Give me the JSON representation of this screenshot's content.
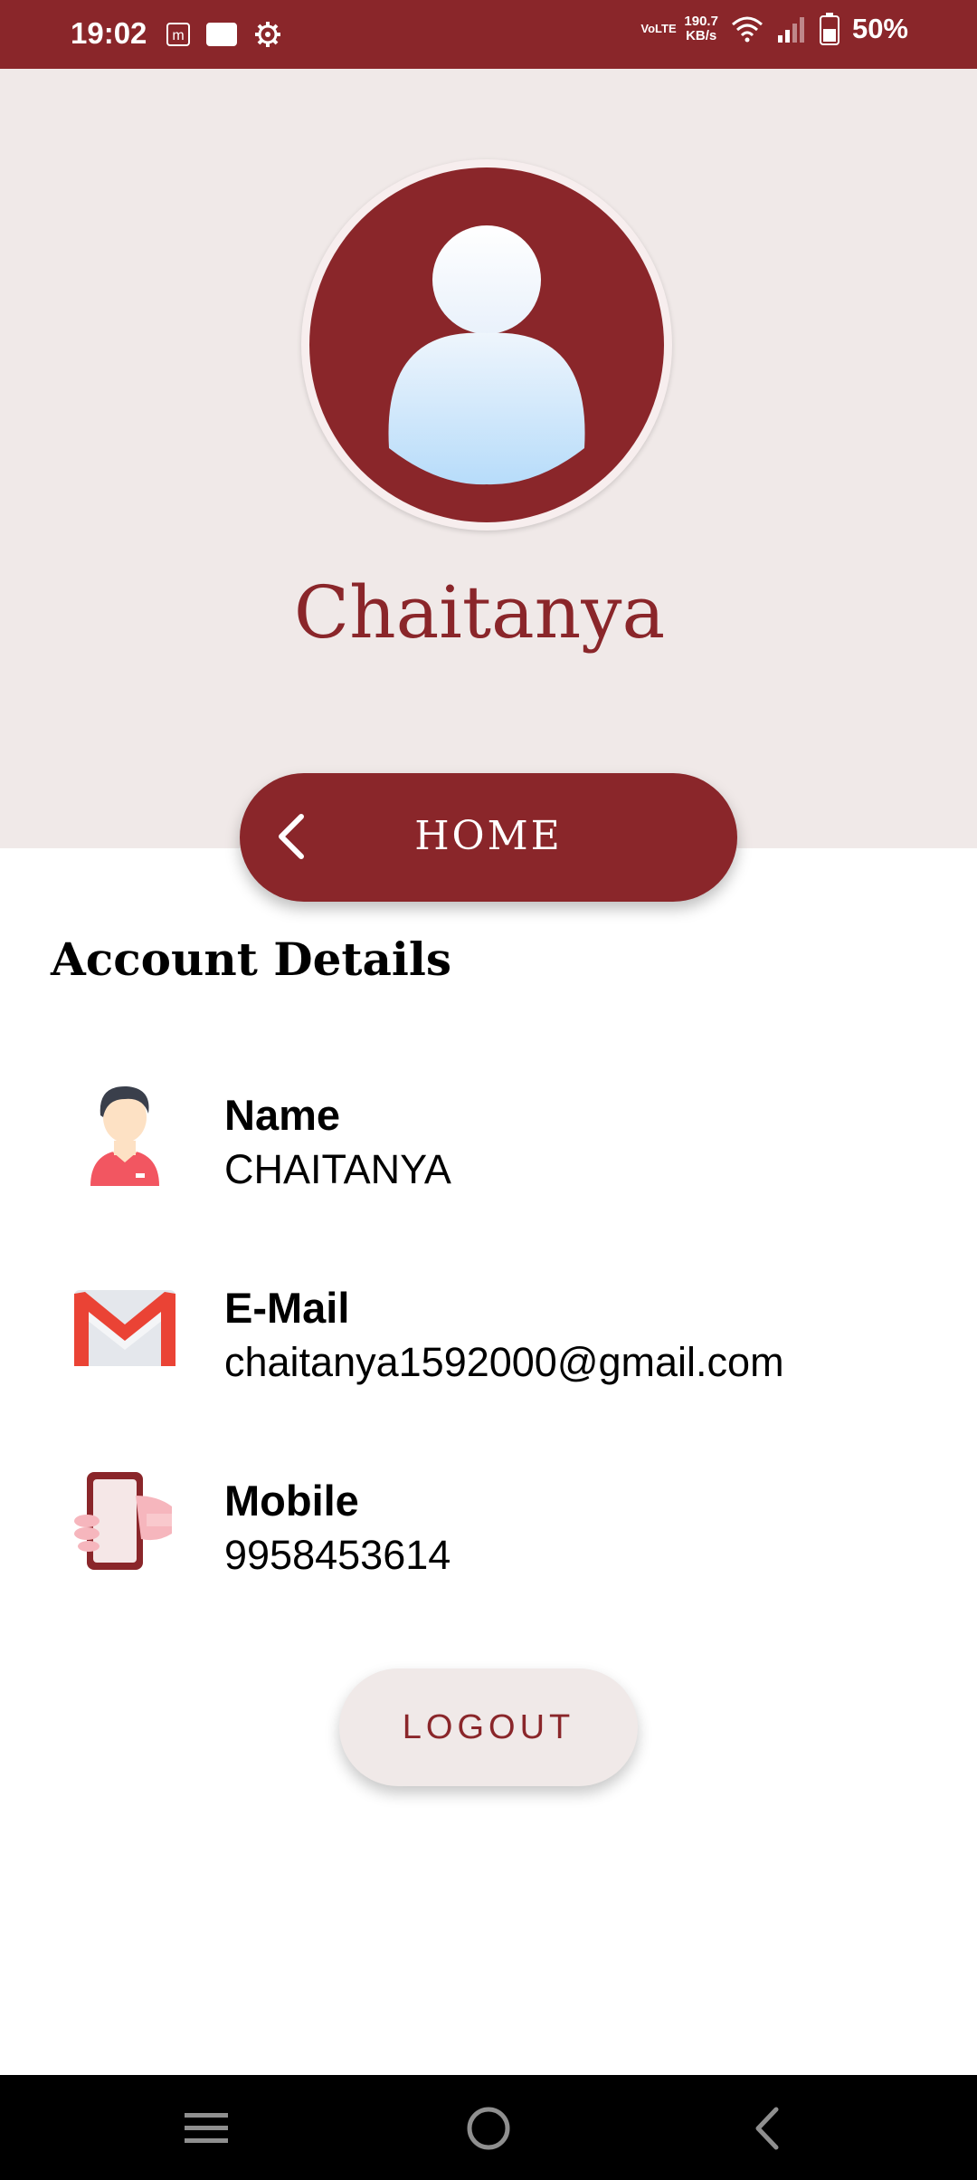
{
  "status_bar": {
    "time": "19:02",
    "network_type": "VoLTE",
    "speed": "190.7",
    "speed_unit": "KB/s",
    "battery": "50%"
  },
  "profile": {
    "name": "Chaitanya"
  },
  "home_button": {
    "label": "HOME"
  },
  "account": {
    "title": "Account Details",
    "items": [
      {
        "label": "Name",
        "value": "CHAITANYA",
        "icon": "person-icon"
      },
      {
        "label": "E-Mail",
        "value": "chaitanya1592000@gmail.com",
        "icon": "gmail-icon"
      },
      {
        "label": "Mobile",
        "value": "9958453614",
        "icon": "phone-icon"
      }
    ]
  },
  "logout_button": {
    "label": "LOGOUT"
  },
  "colors": {
    "primary": "#8a262a",
    "light_bg": "#f0e9e8"
  },
  "nav": {
    "recent_icon": "menu-icon",
    "home_icon": "home-circle-icon",
    "back_icon": "back-icon"
  }
}
